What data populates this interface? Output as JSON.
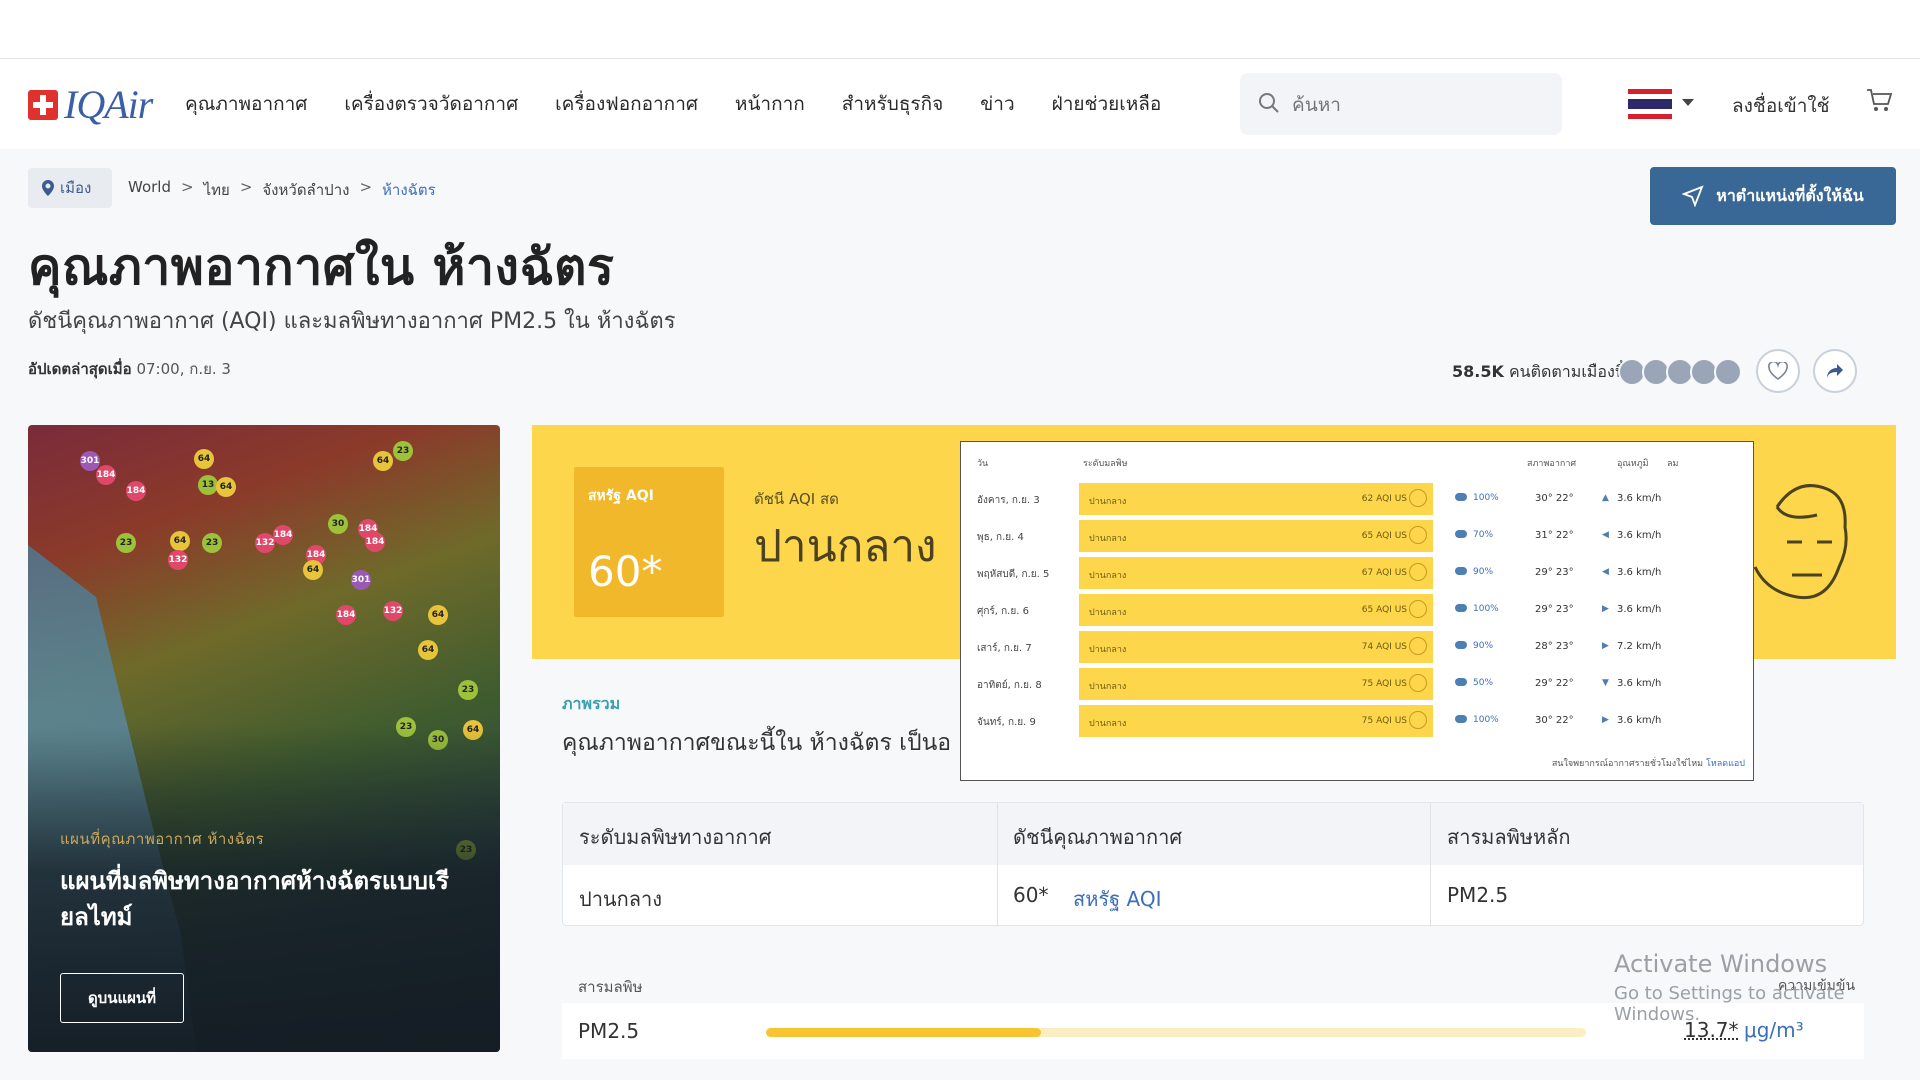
{
  "header": {
    "logo_text": "IQAir",
    "nav": [
      "คุณภาพอากาศ",
      "เครื่องตรวจวัดอากาศ",
      "เครื่องฟอกอากาศ",
      "หน้ากาก",
      "สำหรับธุรกิจ",
      "ข่าว",
      "ฝ่ายช่วยเหลือ"
    ],
    "search_placeholder": "ค้นหา",
    "login_label": "ลงชื่อเข้าใช้",
    "icons": {
      "search": "search-icon",
      "cart": "cart-icon",
      "flag": "thai-flag-icon"
    }
  },
  "breadcrumb": {
    "city_label": "เมือง",
    "items": [
      "World",
      "ไทย",
      "จังหวัดลำปาง",
      "ห้างฉัตร"
    ],
    "separator": ">"
  },
  "locate_button": "หาตำแหน่งที่ตั้งให้ฉัน",
  "page": {
    "title": "คุณภาพอากาศใน ห้างฉัตร",
    "subtitle": "ดัชนีคุณภาพอากาศ (AQI) และมลพิษทางอากาศ PM2.5 ใน ห้างฉัตร",
    "updated_label": "อัปเดตล่าสุดเมื่อ",
    "updated_value": "07:00, ก.ย. 3",
    "followers_count": "58.5K",
    "followers_label": "คนติดตามเมืองนี้"
  },
  "map_card": {
    "kicker": "แผนที่คุณภาพอากาศ ห้างฉัตร",
    "title": "แผนที่มลพิษทางอากาศห้างฉัตรแบบเรียลไทม์",
    "button": "ดูบนแผนที่",
    "markers": [
      "301",
      "184",
      "184",
      "64",
      "13",
      "64",
      "64",
      "23",
      "23",
      "23",
      "64",
      "132",
      "184",
      "132",
      "184",
      "30",
      "184",
      "301",
      "184",
      "64",
      "132",
      "184",
      "64",
      "64",
      "23",
      "23",
      "64",
      "30",
      "23"
    ]
  },
  "aqi": {
    "box_label": "สหรัฐ AQI",
    "value": "60*",
    "live_label": "ดัชนี AQI สด",
    "level": "ปานกลาง",
    "color": "#fdd64b"
  },
  "forecast": {
    "headers": {
      "day": "วัน",
      "level": "ระดับมลพิษ",
      "weather": "สภาพอากาศ",
      "temp": "อุณหภูมิ",
      "wind": "ลม"
    },
    "rows": [
      {
        "day": "อังคาร, ก.ย. 3",
        "level": "ปานกลาง",
        "aqi": "62 AQI US",
        "humidity": "100%",
        "temp": "30°  22°",
        "wind_dir": "▲",
        "wind": "3.6 km/h"
      },
      {
        "day": "พุธ, ก.ย. 4",
        "level": "ปานกลาง",
        "aqi": "65 AQI US",
        "humidity": "70%",
        "temp": "31°  22°",
        "wind_dir": "◀",
        "wind": "3.6 km/h"
      },
      {
        "day": "พฤหัสบดี, ก.ย. 5",
        "level": "ปานกลาง",
        "aqi": "67 AQI US",
        "humidity": "90%",
        "temp": "29°  23°",
        "wind_dir": "◀",
        "wind": "3.6 km/h"
      },
      {
        "day": "ศุกร์, ก.ย. 6",
        "level": "ปานกลาง",
        "aqi": "65 AQI US",
        "humidity": "100%",
        "temp": "29°  23°",
        "wind_dir": "▶",
        "wind": "3.6 km/h"
      },
      {
        "day": "เสาร์, ก.ย. 7",
        "level": "ปานกลาง",
        "aqi": "74 AQI US",
        "humidity": "90%",
        "temp": "28°  23°",
        "wind_dir": "▶",
        "wind": "7.2 km/h"
      },
      {
        "day": "อาทิตย์, ก.ย. 8",
        "level": "ปานกลาง",
        "aqi": "75 AQI US",
        "humidity": "50%",
        "temp": "29°  22°",
        "wind_dir": "▼",
        "wind": "3.6 km/h"
      },
      {
        "day": "จันทร์, ก.ย. 9",
        "level": "ปานกลาง",
        "aqi": "75 AQI US",
        "humidity": "100%",
        "temp": "30°  22°",
        "wind_dir": "▶",
        "wind": "3.6 km/h"
      }
    ],
    "footer_text": "สนใจพยากรณ์อากาศรายชั่วโมงใช่ไหม",
    "footer_link": "โหลดแอป"
  },
  "overview": {
    "kicker": "ภาพรวม",
    "text": "คุณภาพอากาศขณะนี้ใน ห้างฉัตร เป็นอ"
  },
  "summary_table": {
    "headers": [
      "ระดับมลพิษทางอากาศ",
      "ดัชนีคุณภาพอากาศ",
      "สารมลพิษหลัก"
    ],
    "level": "ปานกลาง",
    "aqi_value": "60*",
    "aqi_unit": "สหรัฐ AQI",
    "main_pollutant": "PM2.5"
  },
  "pollutants": {
    "label": "สารมลพิษ",
    "concentration_label": "ความเข้มข้น",
    "items": [
      {
        "name": "PM2.5",
        "value": "13.7*",
        "unit": "μg/m³",
        "level_fraction": 0.335
      }
    ]
  },
  "watermark": {
    "line1": "Activate Windows",
    "line2": "Go to Settings to activate Windows."
  }
}
